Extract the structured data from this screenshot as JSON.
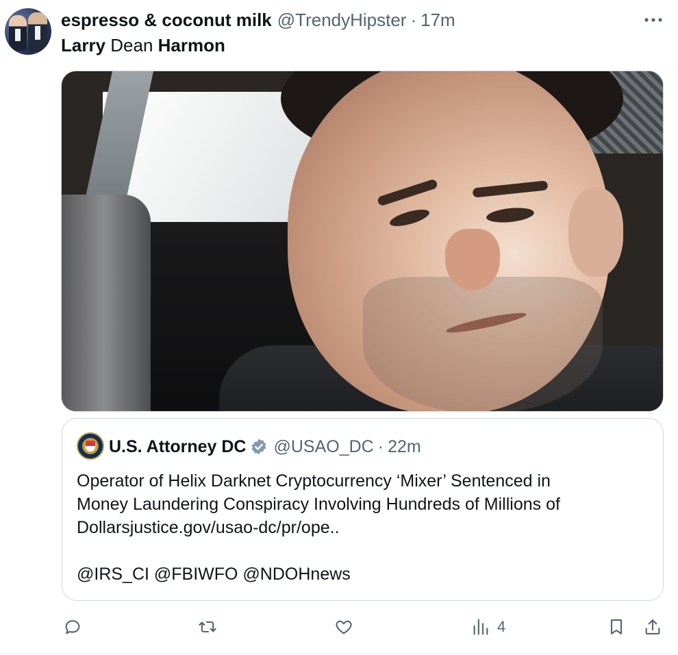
{
  "tweet": {
    "author_name": "espresso & coconut milk",
    "author_handle": "@TrendyHipster",
    "separator": "·",
    "timestamp": "17m",
    "text_parts": [
      "Larry",
      " Dean ",
      "Harmon"
    ],
    "more_icon": "more-horizontal-icon"
  },
  "quoted_tweet": {
    "author_name": "U.S. Attorney DC",
    "author_handle": "@USAO_DC",
    "separator": "·",
    "timestamp": "22m",
    "verified_badge": "gray-verified-badge-icon",
    "body_lines": [
      "Operator of Helix Darknet Cryptocurrency ‘Mixer’ Sentenced in",
      "Money Laundering Conspiracy Involving Hundreds of Millions of",
      "Dollarsjustice.gov/usao-dc/pr/ope..",
      "",
      "@IRS_CI @FBIWFO @NDOHnews"
    ]
  },
  "actions": {
    "reply_icon": "reply-icon",
    "retweet_icon": "retweet-icon",
    "like_icon": "heart-icon",
    "views_icon": "views-bar-chart-icon",
    "views_count": "4",
    "bookmark_icon": "bookmark-icon",
    "share_icon": "share-icon"
  },
  "colors": {
    "text_primary": "#0f1419",
    "text_secondary": "#536471",
    "border": "#cfd9de",
    "verified_gray": "#829aab"
  }
}
